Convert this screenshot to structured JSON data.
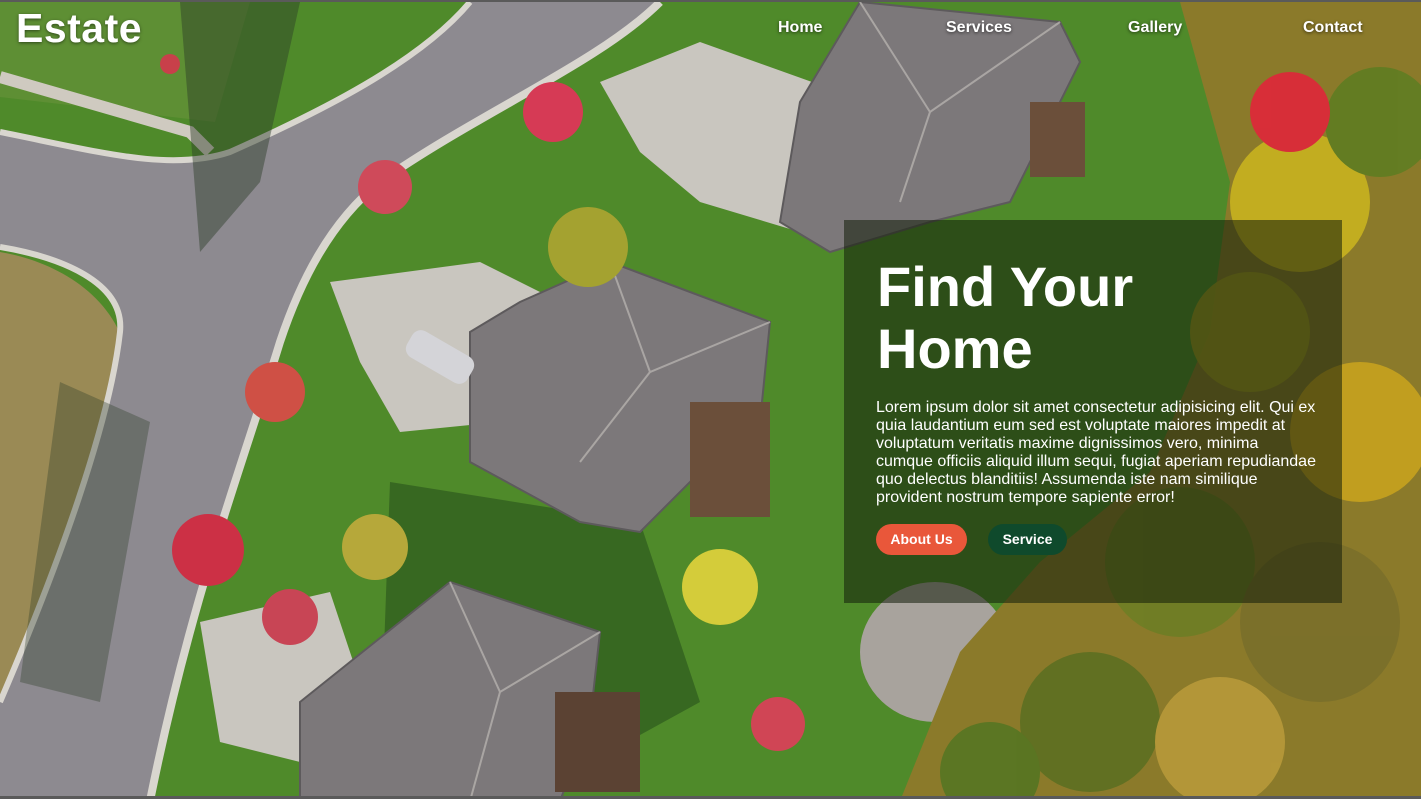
{
  "brand": {
    "logo_text": "Estate"
  },
  "nav": {
    "items": [
      {
        "label": "Home"
      },
      {
        "label": "Services"
      },
      {
        "label": "Gallery"
      },
      {
        "label": "Contact"
      }
    ]
  },
  "hero": {
    "title": "Find Your Home",
    "description": "Lorem ipsum dolor sit amet consectetur adipisicing elit. Qui ex quia laudantium eum sed est voluptate maiores impedit at voluptatum veritatis maxime dignissimos vero, minima cumque officiis aliquid illum sequi, fugiat aperiam repudiandae quo delectus blanditiis! Assumenda iste nam similique provident nostrum tempore sapiente error!",
    "primary_button": "About Us",
    "secondary_button": "Service",
    "background_image": "aerial view of suburban houses, driveways, lawns and autumn trees"
  },
  "colors": {
    "primary_button": "#e9573a",
    "secondary_button": "#0f4a2c",
    "panel_overlay": "rgba(18,30,10,0.55)",
    "text": "#ffffff"
  }
}
